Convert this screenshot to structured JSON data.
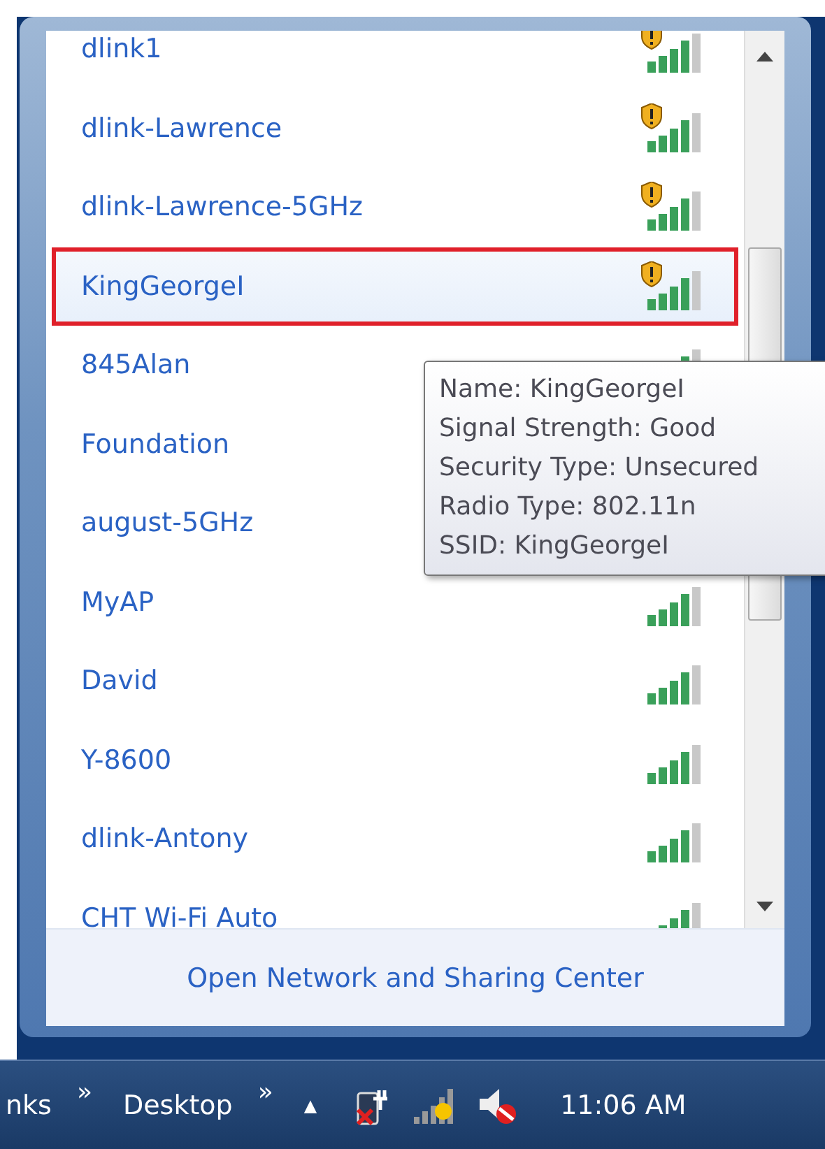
{
  "networks": [
    {
      "name": "dlink1",
      "warning": true,
      "selected": false
    },
    {
      "name": "dlink-Lawrence",
      "warning": true,
      "selected": false
    },
    {
      "name": "dlink-Lawrence-5GHz",
      "warning": true,
      "selected": false
    },
    {
      "name": "KingGeorgeI",
      "warning": true,
      "selected": true
    },
    {
      "name": "845Alan",
      "warning": false,
      "selected": false
    },
    {
      "name": "Foundation",
      "selected": false
    },
    {
      "name": "august-5GHz",
      "selected": false
    },
    {
      "name": "MyAP",
      "warning": false,
      "selected": false
    },
    {
      "name": "David",
      "warning": false,
      "selected": false
    },
    {
      "name": "Y-8600",
      "warning": false,
      "selected": false
    },
    {
      "name": "dlink-Antony",
      "warning": false,
      "selected": false
    },
    {
      "name": "CHT Wi-Fi Auto",
      "warning": false,
      "selected": false
    }
  ],
  "tooltip": {
    "lines": [
      "Name: KingGeorgeI",
      "Signal Strength: Good",
      "Security Type: Unsecured",
      "Radio Type: 802.11n",
      "SSID: KingGeorgeI"
    ]
  },
  "footer": {
    "link": "Open Network and Sharing Center"
  },
  "taskbar": {
    "items": [
      {
        "kind": "label",
        "text": "nks"
      },
      {
        "kind": "chevron",
        "text": "»"
      },
      {
        "kind": "label",
        "text": "Desktop"
      },
      {
        "kind": "chevron",
        "text": "»"
      },
      {
        "kind": "arrow",
        "text": "▲"
      }
    ],
    "clock": "11:06 AM"
  }
}
